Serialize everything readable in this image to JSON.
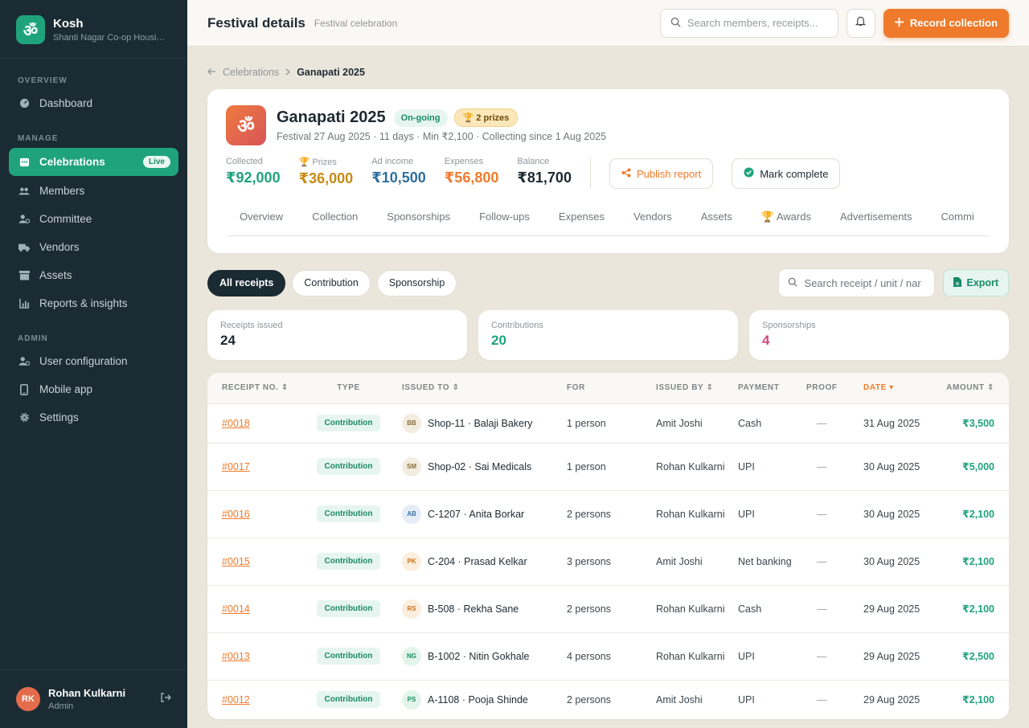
{
  "brand": {
    "logo": "ॐ",
    "name": "Kosh",
    "sub": "Shanti Nagar Co-op Housin..."
  },
  "nav": {
    "overview_label": "OVERVIEW",
    "manage_label": "MANAGE",
    "admin_label": "ADMIN",
    "items": [
      {
        "label": "Dashboard",
        "icon": "dashboard-icon"
      },
      {
        "label": "Celebrations",
        "icon": "calendar-icon",
        "badge": "Live"
      },
      {
        "label": "Members",
        "icon": "users-icon"
      },
      {
        "label": "Committee",
        "icon": "committee-icon"
      },
      {
        "label": "Vendors",
        "icon": "truck-icon"
      },
      {
        "label": "Assets",
        "icon": "archive-icon"
      },
      {
        "label": "Reports & insights",
        "icon": "chart-icon"
      },
      {
        "label": "User configuration",
        "icon": "user-config-icon"
      },
      {
        "label": "Mobile app",
        "icon": "mobile-icon"
      },
      {
        "label": "Settings",
        "icon": "gear-icon"
      }
    ]
  },
  "user": {
    "initials": "RK",
    "name": "Rohan Kulkarni",
    "role": "Admin"
  },
  "topbar": {
    "title": "Festival details",
    "subtitle": "Festival celebration",
    "search_placeholder": "Search members, receipts...",
    "record_label": "Record collection"
  },
  "breadcrumb": {
    "parent": "Celebrations",
    "current": "Ganapati 2025"
  },
  "festival": {
    "logo": "ॐ",
    "title": "Ganapati 2025",
    "status": "On-going",
    "prizes_badge": "2 prizes",
    "meta": "Festival 27 Aug 2025 · 11 days · Min ₹2,100 · Collecting since 1 Aug 2025",
    "stats": [
      {
        "label": "Collected",
        "value": "₹92,000"
      },
      {
        "label": "Prizes",
        "value": "₹36,000"
      },
      {
        "label": "Ad income",
        "value": "₹10,500"
      },
      {
        "label": "Expenses",
        "value": "₹56,800"
      },
      {
        "label": "Balance",
        "value": "₹81,700"
      }
    ],
    "publish_label": "Publish report",
    "complete_label": "Mark complete",
    "tabs": [
      "Overview",
      "Collection",
      "Sponsorships",
      "Follow-ups",
      "Expenses",
      "Vendors",
      "Assets",
      "Awards",
      "Advertisements",
      "Commi"
    ]
  },
  "filters": {
    "pills": [
      "All receipts",
      "Contribution",
      "Sponsorship"
    ],
    "search_placeholder": "Search receipt / unit / nar",
    "export_label": "Export"
  },
  "summary": [
    {
      "label": "Receipts issued",
      "value": "24"
    },
    {
      "label": "Contributions",
      "value": "20"
    },
    {
      "label": "Sponsorships",
      "value": "4"
    }
  ],
  "table": {
    "headers": [
      "RECEIPT NO.",
      "TYPE",
      "ISSUED TO",
      "FOR",
      "ISSUED BY",
      "PAYMENT",
      "PROOF",
      "DATE",
      "AMOUNT"
    ],
    "rows": [
      {
        "no": "#0018",
        "type": "Contribution",
        "initials": "BB",
        "to": "Shop-11 · Balaji Bakery",
        "for": "1 person",
        "by": "Amit Joshi",
        "payment": "Cash",
        "proof": "—",
        "date": "31 Aug 2025",
        "amount": "₹3,500",
        "av_bg": "#f3ece0",
        "av_fg": "#8a6d3b"
      },
      {
        "no": "#0017",
        "type": "Contribution",
        "initials": "SM",
        "to": "Shop-02 · Sai Medicals",
        "for": "1 person",
        "by": "Rohan Kulkarni",
        "payment": "UPI",
        "proof": "—",
        "date": "30 Aug 2025",
        "amount": "₹5,000",
        "av_bg": "#f3ece0",
        "av_fg": "#8a6d3b"
      },
      {
        "no": "#0016",
        "type": "Contribution",
        "initials": "AB",
        "to": "C-1207 · Anita Borkar",
        "for": "2 persons",
        "by": "Rohan Kulkarni",
        "payment": "UPI",
        "proof": "—",
        "date": "30 Aug 2025",
        "amount": "₹2,100",
        "av_bg": "#e5eef8",
        "av_fg": "#3b6ea5"
      },
      {
        "no": "#0015",
        "type": "Contribution",
        "initials": "PK",
        "to": "C-204 · Prasad Kelkar",
        "for": "3 persons",
        "by": "Amit Joshi",
        "payment": "Net banking",
        "proof": "—",
        "date": "30 Aug 2025",
        "amount": "₹2,100",
        "av_bg": "#fbeedd",
        "av_fg": "#c8741e"
      },
      {
        "no": "#0014",
        "type": "Contribution",
        "initials": "RS",
        "to": "B-508 · Rekha Sane",
        "for": "2 persons",
        "by": "Rohan Kulkarni",
        "payment": "Cash",
        "proof": "—",
        "date": "29 Aug 2025",
        "amount": "₹2,100",
        "av_bg": "#fbeedd",
        "av_fg": "#c8741e"
      },
      {
        "no": "#0013",
        "type": "Contribution",
        "initials": "NG",
        "to": "B-1002 · Nitin Gokhale",
        "for": "4 persons",
        "by": "Rohan Kulkarni",
        "payment": "UPI",
        "proof": "—",
        "date": "29 Aug 2025",
        "amount": "₹2,500",
        "av_bg": "#e3f4ec",
        "av_fg": "#1a8b68"
      },
      {
        "no": "#0012",
        "type": "Contribution",
        "initials": "PS",
        "to": "A-1108 · Pooja Shinde",
        "for": "2 persons",
        "by": "Amit Joshi",
        "payment": "UPI",
        "proof": "—",
        "date": "29 Aug 2025",
        "amount": "₹2,100",
        "av_bg": "#e3f4ec",
        "av_fg": "#1a8b68"
      }
    ]
  }
}
